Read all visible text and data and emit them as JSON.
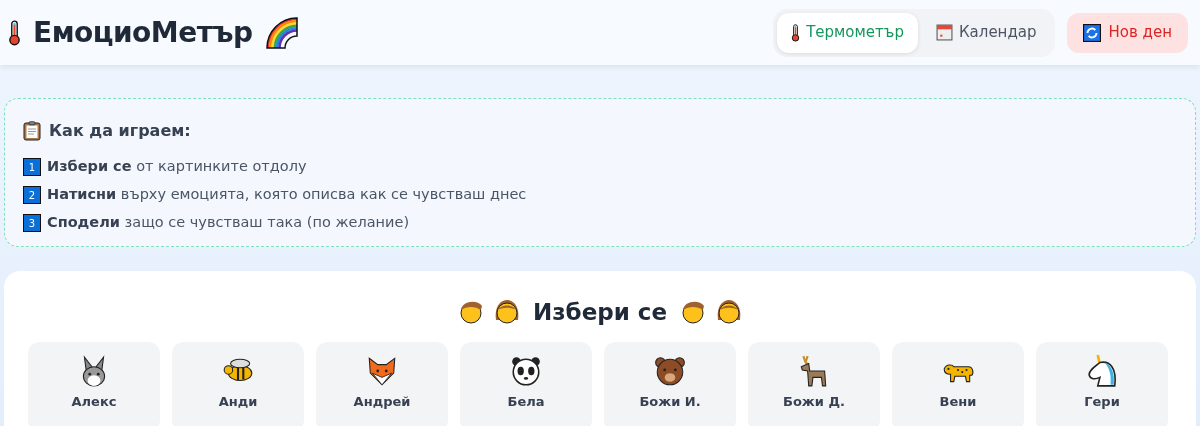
{
  "app": {
    "title": "ЕмоциоМетър"
  },
  "tabs": [
    {
      "label": "Термометър",
      "kind": "thermometer",
      "selected": true
    },
    {
      "label": "Календар",
      "kind": "calendar",
      "selected": false
    }
  ],
  "new_day_button": {
    "label": "Нов ден"
  },
  "instructions": {
    "title": "Как да играем:",
    "steps": [
      {
        "number": "1",
        "text": "**Избери се** от картинките отдолу"
      },
      {
        "number": "2",
        "text": "**Натисни** върху емоцията, която описва как се чувстваш днес"
      },
      {
        "number": "3",
        "text": "**Сподели** защо се чувстваш така (по желание)"
      }
    ]
  },
  "picker": {
    "title": "Избери се",
    "people": [
      {
        "name": "Алекс",
        "kind": "rabbit"
      },
      {
        "name": "Анди",
        "kind": "bee"
      },
      {
        "name": "Андрей",
        "kind": "fox"
      },
      {
        "name": "Бела",
        "kind": "panda"
      },
      {
        "name": "Божи И.",
        "kind": "bear"
      },
      {
        "name": "Божи Д.",
        "kind": "deer"
      },
      {
        "name": "Вени",
        "kind": "leopard"
      },
      {
        "name": "Гери",
        "kind": "unicorn"
      }
    ]
  }
}
